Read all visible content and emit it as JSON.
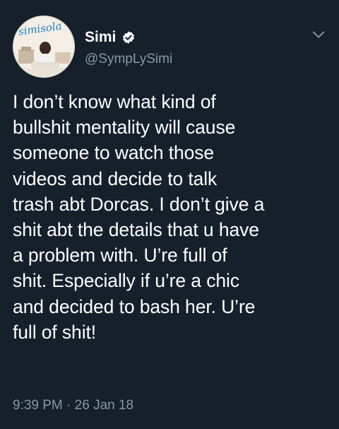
{
  "tweet": {
    "avatar_logo_text": "simisola",
    "display_name": "Simi",
    "handle": "@SympLySimi",
    "text_lines": [
      "I don’t know what kind of",
      "bullshit mentality will cause",
      "someone to watch those",
      "videos and decide to talk",
      "trash abt Dorcas. I don’t give a",
      "shit abt the details that u have",
      "a problem with. U’re full of",
      "shit. Especially if u’re a chic",
      "and decided to bash her. U’re",
      "full of shit!"
    ],
    "time": "9:39 PM",
    "separator": "·",
    "date": "26 Jan 18"
  },
  "icons": {
    "verified": "verified-badge-icon",
    "menu": "chevron-down-icon"
  },
  "colors": {
    "background": "#15202b",
    "text": "#ffffff",
    "secondary": "#8899a6",
    "verified_badge": "#ffffff"
  }
}
